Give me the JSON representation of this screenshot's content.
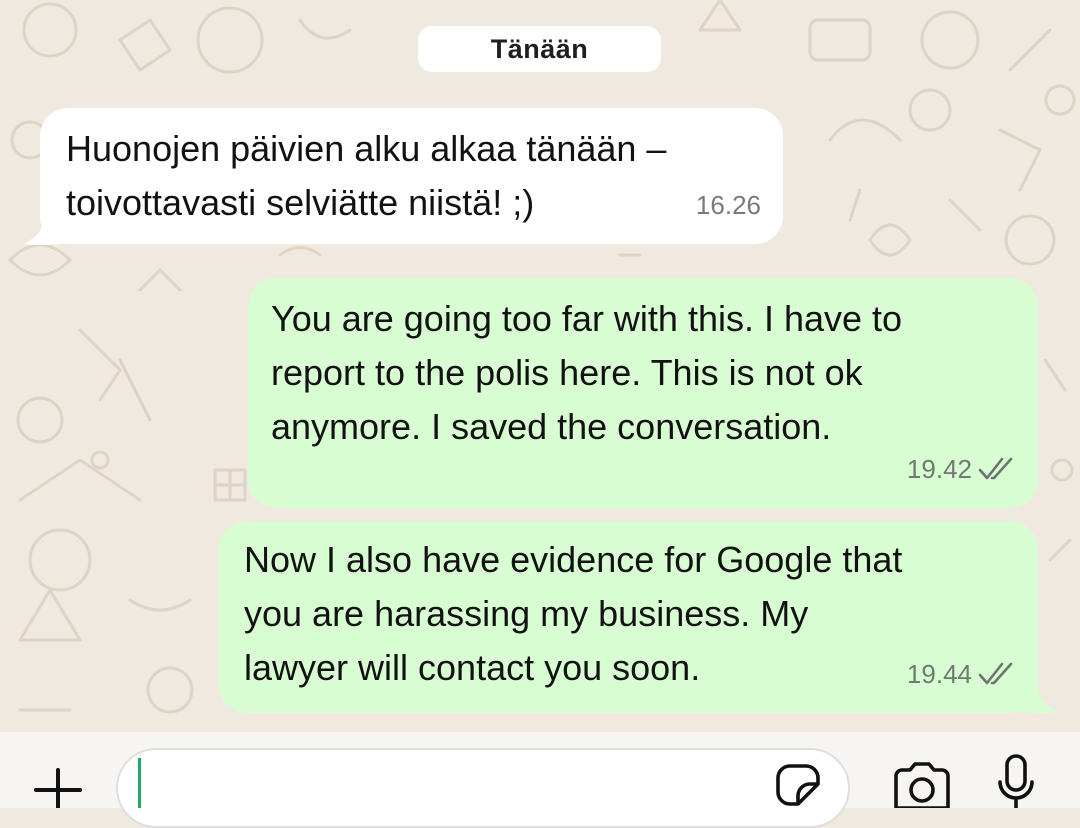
{
  "chat": {
    "date_label": "Tänään",
    "messages": [
      {
        "direction": "incoming",
        "lines": [
          "Huonojen päivien alku alkaa tänään –",
          "toivottavasti selviätte niistä! ;)"
        ],
        "time": "16.26"
      },
      {
        "direction": "outgoing",
        "lines": [
          "You are going too far with this. I have to",
          "report to the polis here. This is not ok",
          "anymore. I saved the conversation."
        ],
        "time": "19.42",
        "status_icon": "double-check-icon"
      },
      {
        "direction": "outgoing",
        "lines": [
          "Now I also have evidence for Google that",
          "you are harassing my business. My",
          "lawyer will contact you soon."
        ],
        "time": "19.44",
        "status_icon": "double-check-icon"
      }
    ]
  },
  "composer": {
    "text_value": "",
    "icons": [
      "plus-icon",
      "sticker-icon",
      "camera-icon",
      "microphone-icon"
    ]
  },
  "colors": {
    "wallpaper": "#efe9df",
    "incoming_bubble": "#ffffff",
    "outgoing_bubble": "#d9fdd3",
    "caret": "#1daa61"
  }
}
